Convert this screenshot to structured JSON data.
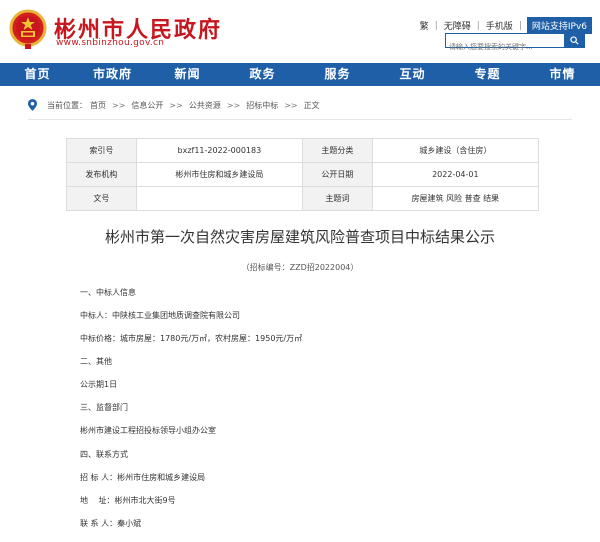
{
  "header": {
    "site_title": "彬州市人民政府",
    "site_url": "www.snbinzhou.gov.cn",
    "toplinks": [
      "繁",
      "无障碍",
      "手机版"
    ],
    "ipv6_label": "网站支持IPv6",
    "search_placeholder": "请输入您要搜索的关键字..."
  },
  "nav": {
    "items": [
      "首页",
      "市政府",
      "新闻",
      "政务",
      "服务",
      "互动",
      "专题",
      "市情"
    ]
  },
  "breadcrumb": {
    "prefix": "当前位置：",
    "items": [
      "首页",
      "信息公开",
      "公共资源",
      "招标中标",
      "正文"
    ],
    "separator": ">>"
  },
  "info_table": {
    "rows": [
      {
        "k1": "索引号",
        "v1": "bxzf11-2022-000183",
        "k2": "主题分类",
        "v2": "城乡建设（含住房）"
      },
      {
        "k1": "发布机构",
        "v1": "彬州市住房和城乡建设局",
        "k2": "公开日期",
        "v2": "2022-04-01"
      },
      {
        "k1": "文号",
        "v1": "",
        "k2": "主题词",
        "v2": "房屋建筑 风险 普查 结果"
      }
    ]
  },
  "article": {
    "title": "彬州市第一次自然灾害房屋建筑风险普查项目中标结果公示",
    "subtitle": "（招标编号：ZZD招2022004）",
    "paragraphs": [
      "一、中标人信息",
      "中标人：中陕核工业集团地质调查院有限公司",
      "中标价格：城市房屋：1780元/万㎡，农村房屋：1950元/万㎡",
      "二、其他",
      "公示期1日",
      "三、监督部门",
      "彬州市建设工程招投标领导小组办公室",
      "四、联系方式",
      "招 标 人：彬州市住房和城乡建设局",
      "地　 址：彬州市北大街9号",
      "联 系 人：秦小斌"
    ]
  },
  "colors": {
    "brand_red": "#c8161e",
    "nav_blue": "#1f5fa8"
  }
}
